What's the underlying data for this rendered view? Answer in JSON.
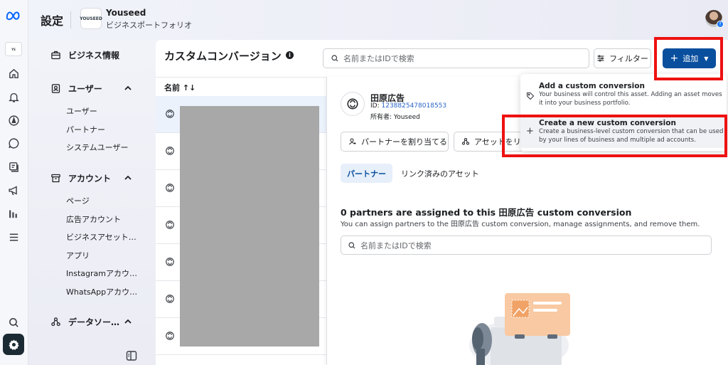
{
  "header": {
    "page_title": "設定",
    "business_logo_text": "YOUSEED",
    "business_name": "Youseed",
    "business_subtitle": "ビジネスポートフォリオ"
  },
  "rail": {
    "logo_icon": "meta-logo-icon",
    "items": [
      "business-logo-icon",
      "home-icon",
      "bell-icon",
      "compass-icon",
      "chat-icon",
      "pages-icon",
      "megaphone-icon",
      "chart-icon",
      "menu-icon"
    ],
    "bottom_items": [
      "search-icon",
      "settings-icon"
    ]
  },
  "nav": {
    "sections": [
      {
        "label": "ビジネス情報",
        "icon": "briefcase-icon",
        "items": []
      },
      {
        "label": "ユーザー",
        "icon": "person-badge-icon",
        "items": [
          "ユーザー",
          "パートナー",
          "システムユーザー"
        ]
      },
      {
        "label": "アカウント",
        "icon": "archive-icon",
        "items": [
          "ページ",
          "広告アカウント",
          "ビジネスアセット…",
          "アプリ",
          "Instagramアカウ…",
          "WhatsAppアカウ…"
        ]
      },
      {
        "label": "データソー…",
        "icon": "data-sources-icon",
        "items": []
      }
    ]
  },
  "main": {
    "title": "カスタムコンバージョン",
    "search_placeholder": "名前またはIDで検索",
    "filter_label": "フィルター",
    "add_label": "追加",
    "column_name": "名前 ↑↓"
  },
  "detail": {
    "name": "田原広告",
    "id_label": "ID:",
    "id_value": "1238825478018553",
    "owner": "所有者: Youseed",
    "assign_partner_label": "パートナーを割り当てる",
    "asset_link_label": "アセットをリン",
    "tabs": [
      "パートナー",
      "リンク済みのアセット"
    ],
    "empty_title": "0 partners are assigned to this 田原広告 custom conversion",
    "empty_subtitle": "You can assign partners to the 田原広告 custom conversion, manage assignments, and remove them.",
    "search_placeholder": "名前またはIDで検索"
  },
  "dropdown": {
    "items": [
      {
        "title": "Add a custom conversion",
        "description": "Your business will control this asset. Adding an asset moves it into your business portfolio.",
        "icon": "tag-icon"
      },
      {
        "title": "Create a new custom conversion",
        "description": "Create a business-level custom conversion that can be used by your lines of business and multiple ad accounts.",
        "icon": "plus-icon"
      }
    ]
  },
  "colors": {
    "primary": "#0a4f9e",
    "highlight": "#ee1111",
    "link": "#2a64c5"
  }
}
